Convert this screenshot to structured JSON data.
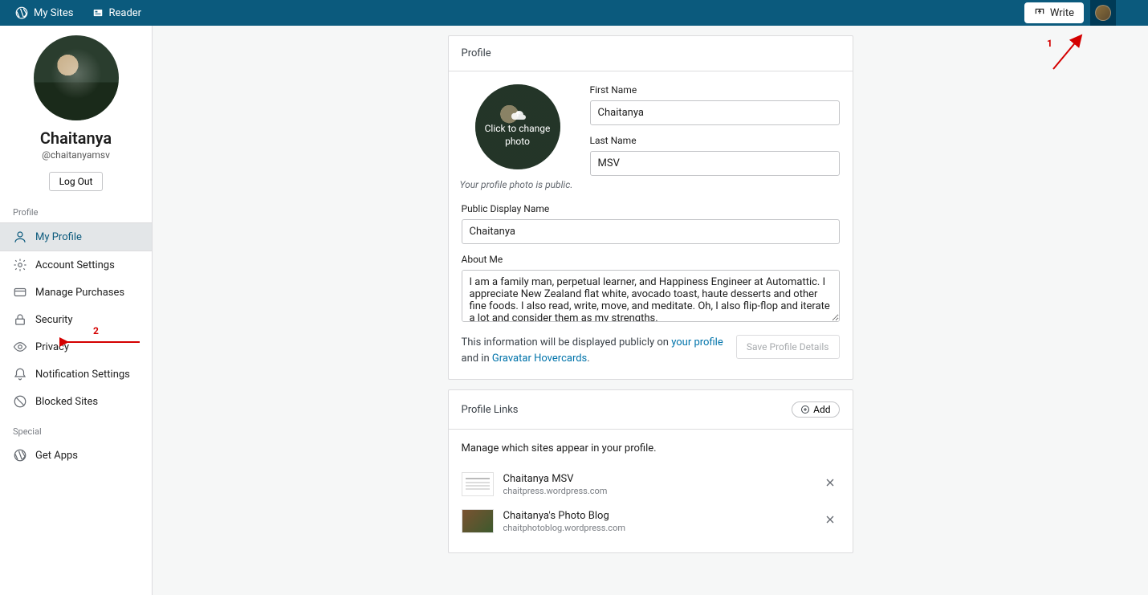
{
  "topbar": {
    "my_sites": "My Sites",
    "reader": "Reader",
    "write": "Write"
  },
  "sidebar": {
    "display_name": "Chaitanya",
    "handle": "@chaitanyamsv",
    "logout": "Log Out",
    "section_profile": "Profile",
    "section_special": "Special",
    "items": [
      {
        "label": "My Profile"
      },
      {
        "label": "Account Settings"
      },
      {
        "label": "Manage Purchases"
      },
      {
        "label": "Security"
      },
      {
        "label": "Privacy"
      },
      {
        "label": "Notification Settings"
      },
      {
        "label": "Blocked Sites"
      }
    ],
    "get_apps": "Get Apps"
  },
  "profile_card": {
    "header": "Profile",
    "photo_change": "Click to change photo",
    "photo_note": "Your profile photo is public.",
    "first_name_label": "First Name",
    "first_name": "Chaitanya",
    "last_name_label": "Last Name",
    "last_name": "MSV",
    "display_label": "Public Display Name",
    "display_name": "Chaitanya",
    "about_label": "About Me",
    "about": "I am a family man, perpetual learner, and Happiness Engineer at Automattic. I appreciate New Zealand flat white, avocado toast, haute desserts and other fine foods. I also read, write, move, and meditate. Oh, I also flip-flop and iterate a lot and consider them as my strengths.",
    "info_pre": "This information will be displayed publicly on ",
    "info_link1": "your profile",
    "info_mid": " and in ",
    "info_link2": "Gravatar Hovercards",
    "info_post": ".",
    "save": "Save Profile Details"
  },
  "links_card": {
    "header": "Profile Links",
    "add": "Add",
    "desc": "Manage which sites appear in your profile.",
    "links": [
      {
        "title": "Chaitanya MSV",
        "url": "chaitpress.wordpress.com"
      },
      {
        "title": "Chaitanya's Photo Blog",
        "url": "chaitphotoblog.wordpress.com"
      }
    ]
  },
  "annotations": {
    "n1": "1",
    "n2": "2"
  }
}
